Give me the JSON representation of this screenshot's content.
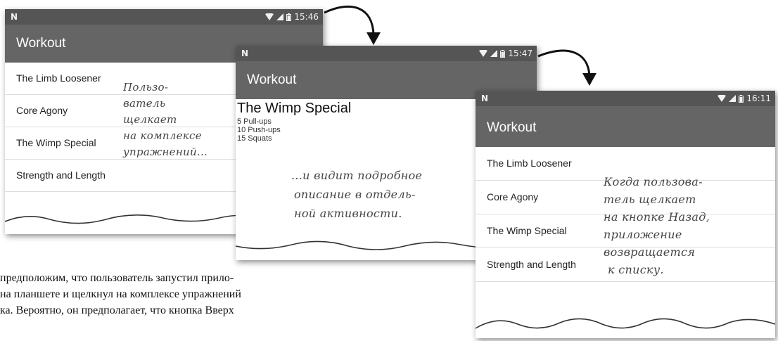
{
  "screens": [
    {
      "status_icon": "N",
      "time": "15:46",
      "title": "Workout",
      "items": [
        "The Limb Loosener",
        "Core Agony",
        "The Wimp Special",
        "Strength and Length"
      ],
      "note_lines": [
        "Пользо-",
        "ватель",
        "щелкает",
        "на комплексе",
        "упражнений..."
      ]
    },
    {
      "status_icon": "N",
      "time": "15:47",
      "title": "Workout",
      "detail": {
        "name": "The Wimp Special",
        "lines": [
          "5 Pull-ups",
          "10 Push-ups",
          "15 Squats"
        ]
      },
      "note_lines": [
        "...и видит подробное",
        "описание в отдель-",
        "ной активности."
      ]
    },
    {
      "status_icon": "N",
      "time": "16:11",
      "title": "Workout",
      "items": [
        "The Limb Loosener",
        "Core Agony",
        "The Wimp Special",
        "Strength and Length"
      ],
      "note_lines": [
        "Когда пользова-",
        "тель щелкает",
        "на кнопке Назад,",
        "приложение",
        "возвращается",
        "к списку."
      ]
    }
  ],
  "body_text": [
    "предположим, что пользователь запустил прило-",
    "на планшете и щелкнул на комплексе упражнений",
    "ка. Вероятно, он предполагает, что кнопка Вверх"
  ],
  "colors": {
    "status_bar": "#555555",
    "toolbar": "#656565",
    "annotation": "#444444"
  },
  "icons": [
    "wifi-icon",
    "signal-icon",
    "battery-icon",
    "flow-arrow-icon"
  ]
}
